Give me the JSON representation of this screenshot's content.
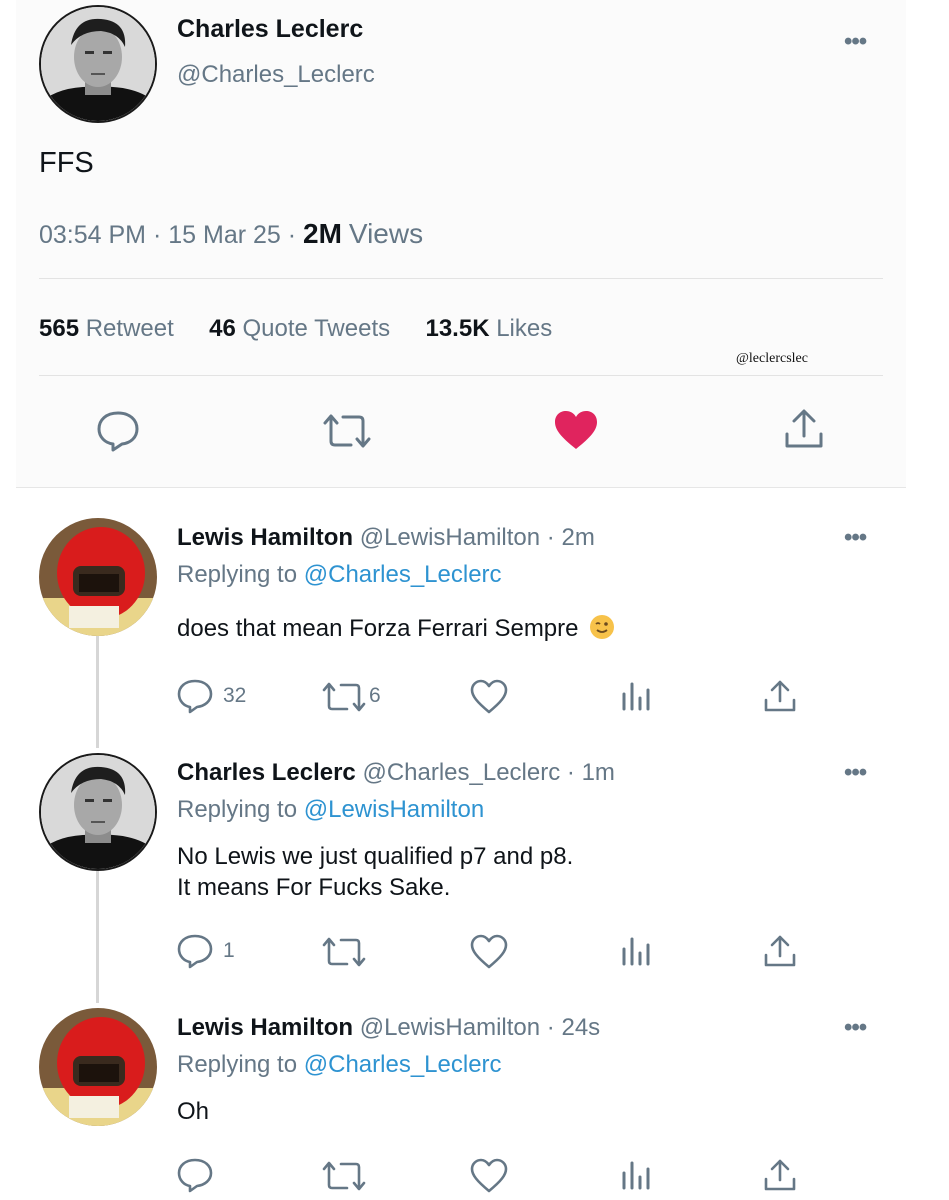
{
  "main_tweet": {
    "name": "Charles Leclerc",
    "handle": "@Charles_Leclerc",
    "text": "FFS",
    "time": "03:54 PM",
    "date": "15 Mar 25",
    "views_count": "2M",
    "views_label": "Views",
    "retweets_count": "565",
    "retweets_label": "Retweet",
    "quotes_count": "46",
    "quotes_label": "Quote Tweets",
    "likes_count": "13.5K",
    "likes_label": "Likes",
    "watermark": "@leclercslec",
    "liked": true,
    "like_color": "#e0245e"
  },
  "replying_label": "Replying to",
  "replies": [
    {
      "name": "Lewis Hamilton",
      "handle": "@LewisHamilton",
      "time": "2m",
      "replying_to": "@Charles_Leclerc",
      "text": "does that mean Forza Ferrari Sempre",
      "emoji": "winking-face",
      "reply_count": "32",
      "retweet_count": "6"
    },
    {
      "name": "Charles Leclerc",
      "handle": "@Charles_Leclerc",
      "time": "1m",
      "replying_to": "@LewisHamilton",
      "text_line1": "No Lewis we just qualified p7 and p8.",
      "text_line2": "It means For Fucks Sake.",
      "reply_count": "1",
      "retweet_count": ""
    },
    {
      "name": "Lewis Hamilton",
      "handle": "@LewisHamilton",
      "time": "24s",
      "replying_to": "@Charles_Leclerc",
      "text": "Oh",
      "reply_count": "",
      "retweet_count": ""
    }
  ],
  "colors": {
    "link": "#2e93d1",
    "muted": "#657786",
    "like": "#e0245e"
  }
}
